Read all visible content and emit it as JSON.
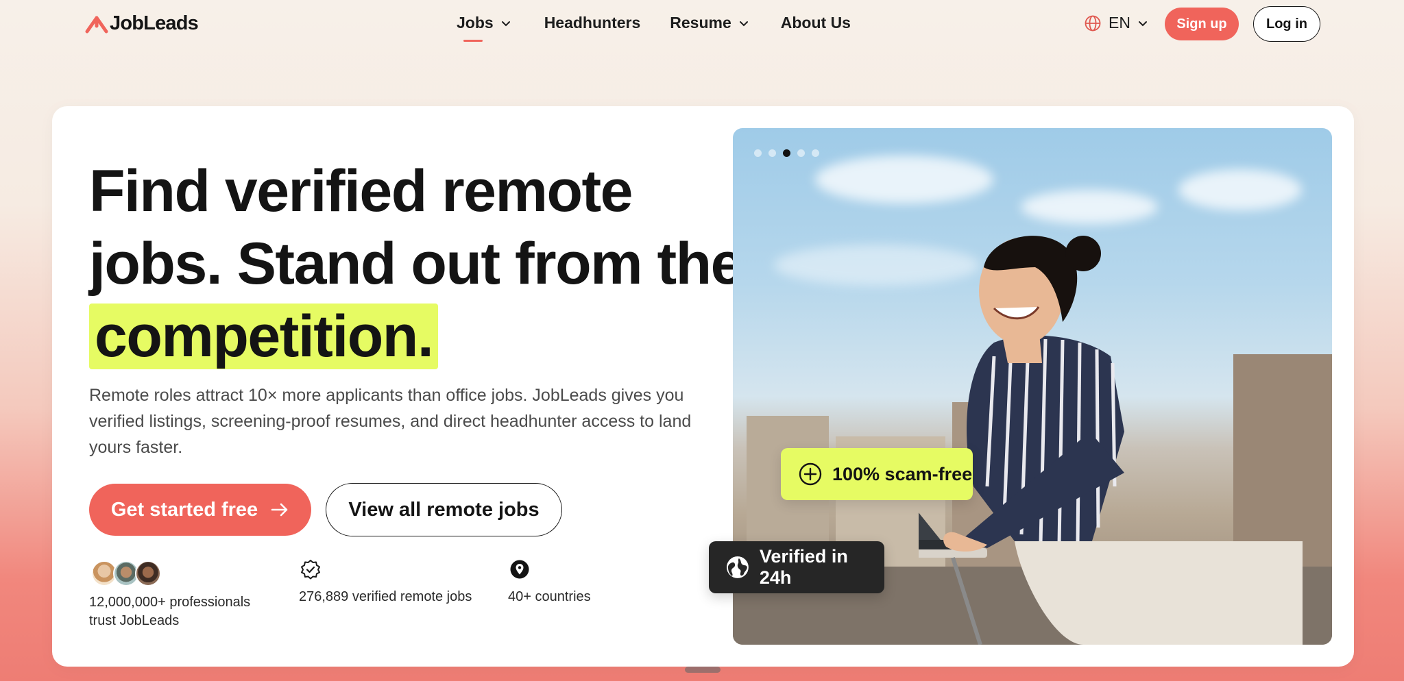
{
  "brand": {
    "name": "JobLeads",
    "accent": "#f0645b",
    "highlight": "#e6fb63"
  },
  "nav": {
    "links": [
      {
        "label": "Jobs",
        "has_dropdown": true,
        "active": true
      },
      {
        "label": "Headhunters",
        "has_dropdown": false
      },
      {
        "label": "Resume",
        "has_dropdown": true
      },
      {
        "label": "About Us",
        "has_dropdown": false
      }
    ],
    "language": "EN",
    "signup_label": "Sign up",
    "login_label": "Log in"
  },
  "hero": {
    "headline_line1": "Find verified remote",
    "headline_line2": "jobs. Stand out from the",
    "headline_highlight": "competition.",
    "subtitle": "Remote roles attract 10× more applicants than office jobs. JobLeads gives you verified listings, screening-proof resumes, and direct headhunter access to land yours faster.",
    "cta_primary": "Get started free",
    "cta_secondary": "View all remote jobs",
    "stats": [
      {
        "icon": "avatars",
        "text": "12,000,000+ professionals trust JobLeads"
      },
      {
        "icon": "verified-badge-icon",
        "text": "276,889 verified remote jobs"
      },
      {
        "icon": "location-pin-icon",
        "text": "40+ countries"
      }
    ]
  },
  "carousel": {
    "slide_count": 5,
    "active_index": 2,
    "badge_scam": "100% scam-free",
    "badge_verified": "Verified in 24h"
  }
}
